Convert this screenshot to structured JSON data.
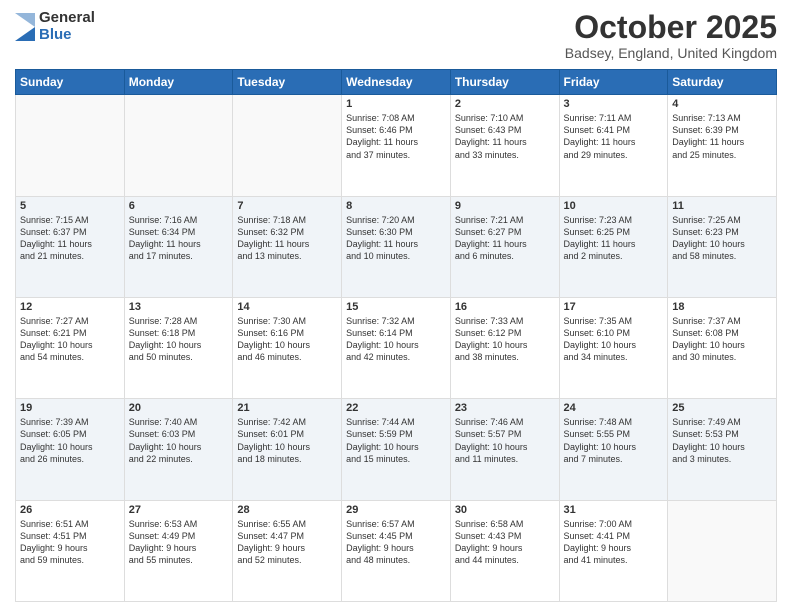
{
  "logo": {
    "general": "General",
    "blue": "Blue"
  },
  "header": {
    "month": "October 2025",
    "location": "Badsey, England, United Kingdom"
  },
  "weekdays": [
    "Sunday",
    "Monday",
    "Tuesday",
    "Wednesday",
    "Thursday",
    "Friday",
    "Saturday"
  ],
  "weeks": [
    [
      {
        "day": "",
        "info": ""
      },
      {
        "day": "",
        "info": ""
      },
      {
        "day": "",
        "info": ""
      },
      {
        "day": "1",
        "info": "Sunrise: 7:08 AM\nSunset: 6:46 PM\nDaylight: 11 hours\nand 37 minutes."
      },
      {
        "day": "2",
        "info": "Sunrise: 7:10 AM\nSunset: 6:43 PM\nDaylight: 11 hours\nand 33 minutes."
      },
      {
        "day": "3",
        "info": "Sunrise: 7:11 AM\nSunset: 6:41 PM\nDaylight: 11 hours\nand 29 minutes."
      },
      {
        "day": "4",
        "info": "Sunrise: 7:13 AM\nSunset: 6:39 PM\nDaylight: 11 hours\nand 25 minutes."
      }
    ],
    [
      {
        "day": "5",
        "info": "Sunrise: 7:15 AM\nSunset: 6:37 PM\nDaylight: 11 hours\nand 21 minutes."
      },
      {
        "day": "6",
        "info": "Sunrise: 7:16 AM\nSunset: 6:34 PM\nDaylight: 11 hours\nand 17 minutes."
      },
      {
        "day": "7",
        "info": "Sunrise: 7:18 AM\nSunset: 6:32 PM\nDaylight: 11 hours\nand 13 minutes."
      },
      {
        "day": "8",
        "info": "Sunrise: 7:20 AM\nSunset: 6:30 PM\nDaylight: 11 hours\nand 10 minutes."
      },
      {
        "day": "9",
        "info": "Sunrise: 7:21 AM\nSunset: 6:27 PM\nDaylight: 11 hours\nand 6 minutes."
      },
      {
        "day": "10",
        "info": "Sunrise: 7:23 AM\nSunset: 6:25 PM\nDaylight: 11 hours\nand 2 minutes."
      },
      {
        "day": "11",
        "info": "Sunrise: 7:25 AM\nSunset: 6:23 PM\nDaylight: 10 hours\nand 58 minutes."
      }
    ],
    [
      {
        "day": "12",
        "info": "Sunrise: 7:27 AM\nSunset: 6:21 PM\nDaylight: 10 hours\nand 54 minutes."
      },
      {
        "day": "13",
        "info": "Sunrise: 7:28 AM\nSunset: 6:18 PM\nDaylight: 10 hours\nand 50 minutes."
      },
      {
        "day": "14",
        "info": "Sunrise: 7:30 AM\nSunset: 6:16 PM\nDaylight: 10 hours\nand 46 minutes."
      },
      {
        "day": "15",
        "info": "Sunrise: 7:32 AM\nSunset: 6:14 PM\nDaylight: 10 hours\nand 42 minutes."
      },
      {
        "day": "16",
        "info": "Sunrise: 7:33 AM\nSunset: 6:12 PM\nDaylight: 10 hours\nand 38 minutes."
      },
      {
        "day": "17",
        "info": "Sunrise: 7:35 AM\nSunset: 6:10 PM\nDaylight: 10 hours\nand 34 minutes."
      },
      {
        "day": "18",
        "info": "Sunrise: 7:37 AM\nSunset: 6:08 PM\nDaylight: 10 hours\nand 30 minutes."
      }
    ],
    [
      {
        "day": "19",
        "info": "Sunrise: 7:39 AM\nSunset: 6:05 PM\nDaylight: 10 hours\nand 26 minutes."
      },
      {
        "day": "20",
        "info": "Sunrise: 7:40 AM\nSunset: 6:03 PM\nDaylight: 10 hours\nand 22 minutes."
      },
      {
        "day": "21",
        "info": "Sunrise: 7:42 AM\nSunset: 6:01 PM\nDaylight: 10 hours\nand 18 minutes."
      },
      {
        "day": "22",
        "info": "Sunrise: 7:44 AM\nSunset: 5:59 PM\nDaylight: 10 hours\nand 15 minutes."
      },
      {
        "day": "23",
        "info": "Sunrise: 7:46 AM\nSunset: 5:57 PM\nDaylight: 10 hours\nand 11 minutes."
      },
      {
        "day": "24",
        "info": "Sunrise: 7:48 AM\nSunset: 5:55 PM\nDaylight: 10 hours\nand 7 minutes."
      },
      {
        "day": "25",
        "info": "Sunrise: 7:49 AM\nSunset: 5:53 PM\nDaylight: 10 hours\nand 3 minutes."
      }
    ],
    [
      {
        "day": "26",
        "info": "Sunrise: 6:51 AM\nSunset: 4:51 PM\nDaylight: 9 hours\nand 59 minutes."
      },
      {
        "day": "27",
        "info": "Sunrise: 6:53 AM\nSunset: 4:49 PM\nDaylight: 9 hours\nand 55 minutes."
      },
      {
        "day": "28",
        "info": "Sunrise: 6:55 AM\nSunset: 4:47 PM\nDaylight: 9 hours\nand 52 minutes."
      },
      {
        "day": "29",
        "info": "Sunrise: 6:57 AM\nSunset: 4:45 PM\nDaylight: 9 hours\nand 48 minutes."
      },
      {
        "day": "30",
        "info": "Sunrise: 6:58 AM\nSunset: 4:43 PM\nDaylight: 9 hours\nand 44 minutes."
      },
      {
        "day": "31",
        "info": "Sunrise: 7:00 AM\nSunset: 4:41 PM\nDaylight: 9 hours\nand 41 minutes."
      },
      {
        "day": "",
        "info": ""
      }
    ]
  ]
}
